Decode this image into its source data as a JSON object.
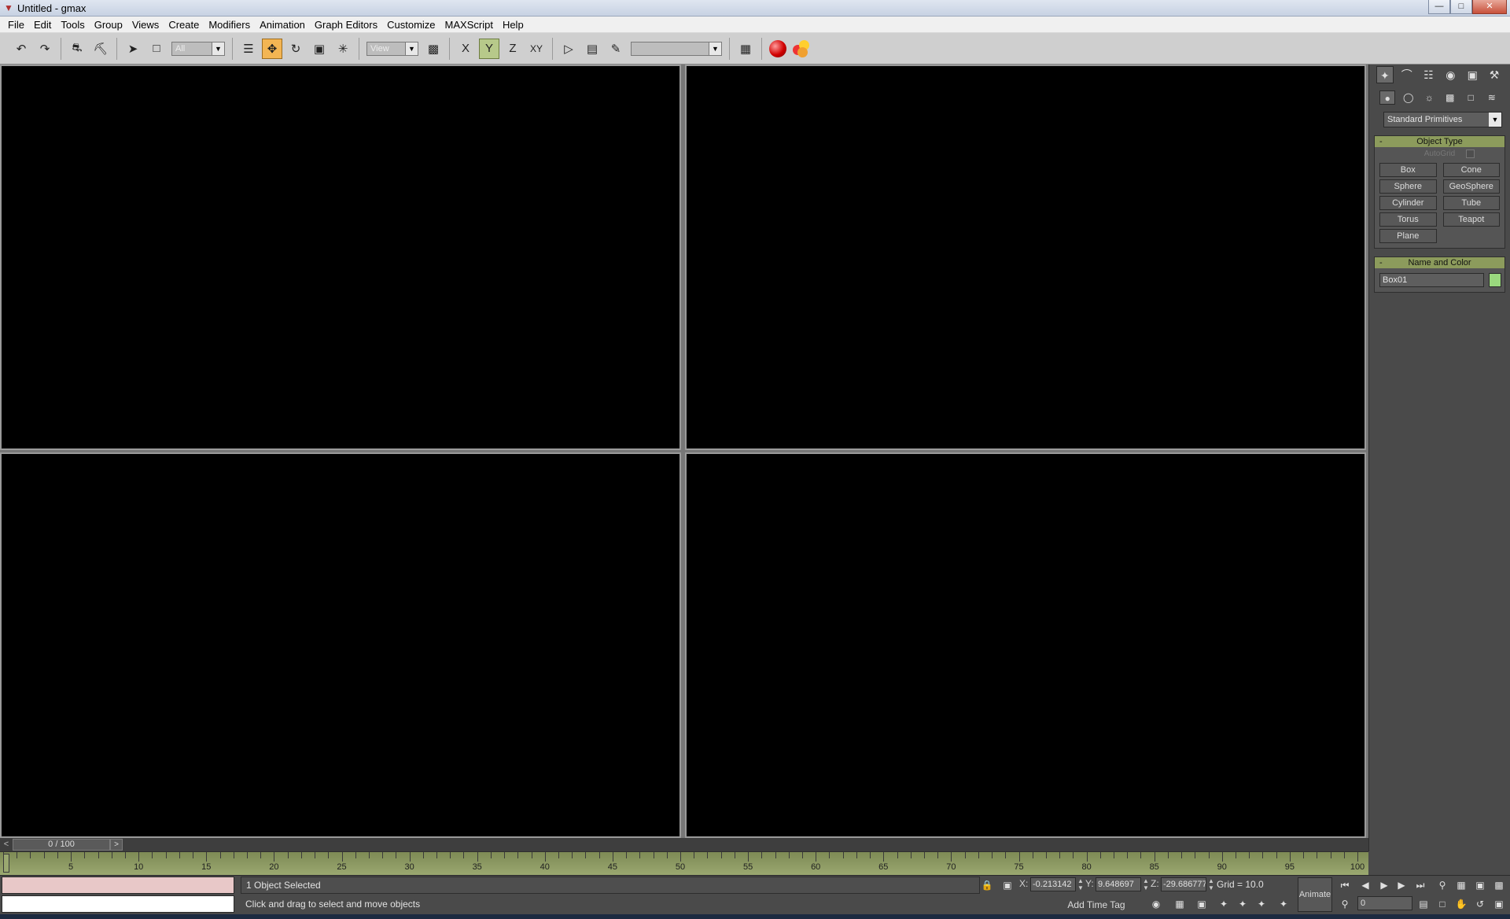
{
  "window": {
    "title": "Untitled - gmax",
    "controls": [
      "minimize",
      "maximize",
      "close"
    ]
  },
  "menubar": {
    "items": [
      "File",
      "Edit",
      "Tools",
      "Group",
      "Views",
      "Create",
      "Modifiers",
      "Animation",
      "Graph Editors",
      "Customize",
      "MAXScript",
      "Help"
    ]
  },
  "toolbar": {
    "selection_filter": "All",
    "reference_coord": "View",
    "named_selection": ""
  },
  "command_panel": {
    "category_dropdown": "Standard Primitives",
    "object_type": {
      "title": "Object Type",
      "autogrid_label": "AutoGrid",
      "buttons": [
        "Box",
        "Cone",
        "Sphere",
        "GeoSphere",
        "Cylinder",
        "Tube",
        "Torus",
        "Teapot",
        "Plane"
      ]
    },
    "name_color": {
      "title": "Name and Color",
      "name_value": "Box01",
      "color": "#9ad97e"
    }
  },
  "time_slider": {
    "label": "0 / 100",
    "prev": "<",
    "next": ">"
  },
  "trackbar": {
    "labels": [
      "5",
      "10",
      "15",
      "20",
      "25",
      "30",
      "35",
      "40",
      "45",
      "50",
      "55",
      "60",
      "65",
      "70",
      "75",
      "80",
      "85",
      "90",
      "95",
      "100"
    ]
  },
  "status": {
    "selection": "1 Object Selected",
    "prompt": "Click and drag to select and move objects",
    "x_label": "X:",
    "x_value": "-0.213142",
    "y_label": "Y:",
    "y_value": "9.648697",
    "z_label": "Z:",
    "z_value": "-29.686777",
    "grid": "Grid = 10.0",
    "add_time_tag": "Add Time Tag",
    "animate": "Animate",
    "frame": "0"
  }
}
